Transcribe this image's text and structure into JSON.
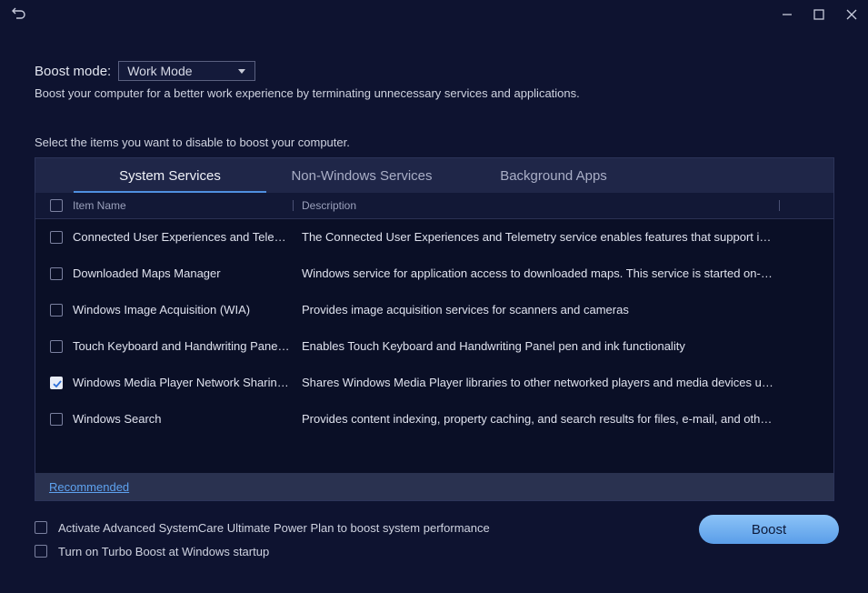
{
  "window": {
    "back_icon": "undo-arrow-icon",
    "controls": [
      "minimize-icon",
      "maximize-icon",
      "close-icon"
    ]
  },
  "boost": {
    "label": "Boost mode:",
    "mode_value": "Work Mode",
    "description": "Boost your computer for a better work experience by terminating unnecessary services and applications."
  },
  "instructions": "Select the items you want to disable to boost your computer.",
  "tabs": [
    {
      "label": "System Services",
      "active": true
    },
    {
      "label": "Non-Windows Services",
      "active": false
    },
    {
      "label": "Background Apps",
      "active": false
    }
  ],
  "columns": {
    "name": "Item Name",
    "description": "Description"
  },
  "rows": [
    {
      "name": "Connected User Experiences and Telemetry",
      "description": "The Connected User Experiences and Telemetry service enables features that support in-application and connected user experiences",
      "checked": false
    },
    {
      "name": "Downloaded Maps Manager",
      "description": "Windows service for application access to downloaded maps. This service is started on-demand by application accessing downloaded maps",
      "checked": false
    },
    {
      "name": "Windows Image Acquisition (WIA)",
      "description": "Provides image acquisition services for scanners and cameras",
      "checked": false
    },
    {
      "name": "Touch Keyboard and Handwriting Panel Service",
      "description": "Enables Touch Keyboard and Handwriting Panel pen and ink functionality",
      "checked": false
    },
    {
      "name": "Windows Media Player Network Sharing Service",
      "description": "Shares Windows Media Player libraries to other networked players and media devices using Universal Plug and Play",
      "checked": true
    },
    {
      "name": "Windows Search",
      "description": "Provides content indexing, property caching, and search results for files, e-mail, and other content",
      "checked": false
    }
  ],
  "footer": {
    "recommended_link": "Recommended"
  },
  "options": [
    {
      "label": "Activate Advanced SystemCare Ultimate Power Plan to boost system performance",
      "checked": false
    },
    {
      "label": "Turn on Turbo Boost at Windows startup",
      "checked": false
    }
  ],
  "action": {
    "boost_label": "Boost"
  },
  "colors": {
    "background": "#0e1330",
    "accent": "#4f8fe0",
    "link": "#5ea2ef",
    "button": "#7ab4f2"
  }
}
